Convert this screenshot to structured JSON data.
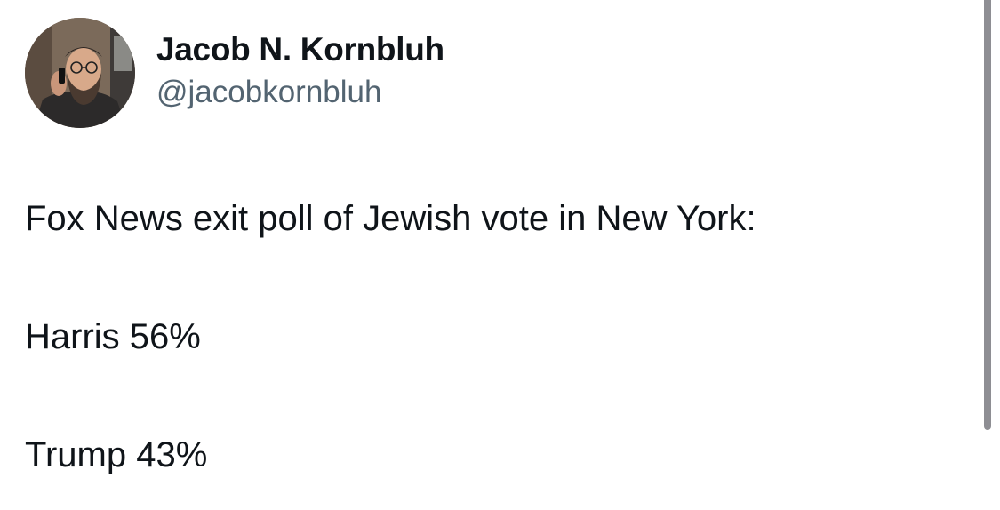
{
  "author": {
    "display_name": "Jacob N. Kornbluh",
    "handle": "@jacobkornbluh",
    "avatar_icon": "profile-photo"
  },
  "tweet": {
    "lines": [
      "Fox News exit poll of Jewish vote in New York:",
      "Harris 56%",
      "Trump 43%"
    ]
  },
  "colors": {
    "text_primary": "#0f1419",
    "text_secondary": "#536471",
    "background": "#ffffff",
    "scrollbar": "#8e8e93"
  }
}
